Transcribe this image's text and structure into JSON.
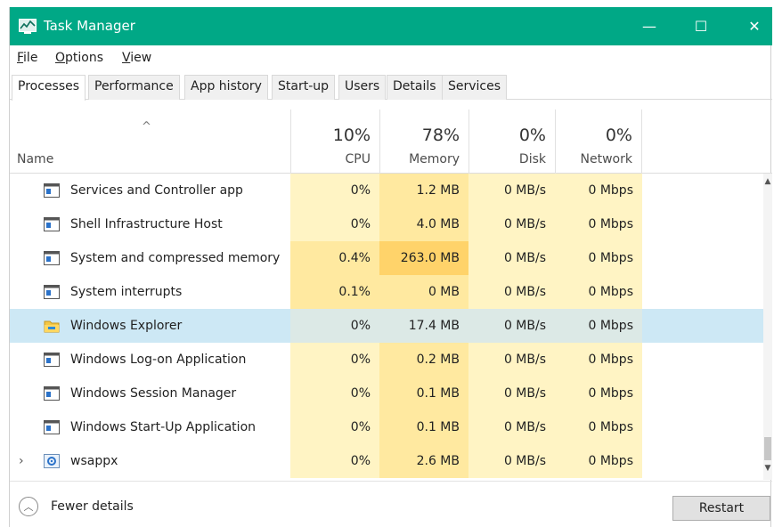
{
  "window": {
    "title": "Task Manager",
    "minimize": "—",
    "maximize": "☐",
    "close": "✕"
  },
  "menu": {
    "file": "File",
    "options": "Options",
    "view": "View"
  },
  "tabs": [
    "Processes",
    "Performance",
    "App history",
    "Start-up",
    "Users",
    "Details",
    "Services"
  ],
  "header": {
    "name_label": "Name",
    "sort_indicator": "^",
    "cpu": {
      "pct": "10%",
      "label": "CPU"
    },
    "memory": {
      "pct": "78%",
      "label": "Memory"
    },
    "disk": {
      "pct": "0%",
      "label": "Disk"
    },
    "network": {
      "pct": "0%",
      "label": "Network"
    }
  },
  "processes": [
    {
      "name": "Services and Controller app",
      "cpu": "0%",
      "memory": "1.2 MB",
      "disk": "0 MB/s",
      "network": "0 Mbps",
      "icon": "window-icon",
      "expandable": false,
      "selected": false
    },
    {
      "name": "Shell Infrastructure Host",
      "cpu": "0%",
      "memory": "4.0 MB",
      "disk": "0 MB/s",
      "network": "0 Mbps",
      "icon": "window-icon",
      "expandable": false,
      "selected": false
    },
    {
      "name": "System and compressed memory",
      "cpu": "0.4%",
      "memory": "263.0 MB",
      "disk": "0 MB/s",
      "network": "0 Mbps",
      "icon": "window-icon",
      "expandable": false,
      "selected": false
    },
    {
      "name": "System interrupts",
      "cpu": "0.1%",
      "memory": "0 MB",
      "disk": "0 MB/s",
      "network": "0 Mbps",
      "icon": "window-icon",
      "expandable": false,
      "selected": false
    },
    {
      "name": "Windows Explorer",
      "cpu": "0%",
      "memory": "17.4 MB",
      "disk": "0 MB/s",
      "network": "0 Mbps",
      "icon": "folder-icon",
      "expandable": false,
      "selected": true
    },
    {
      "name": "Windows Log-on Application",
      "cpu": "0%",
      "memory": "0.2 MB",
      "disk": "0 MB/s",
      "network": "0 Mbps",
      "icon": "window-icon",
      "expandable": false,
      "selected": false
    },
    {
      "name": "Windows Session Manager",
      "cpu": "0%",
      "memory": "0.1 MB",
      "disk": "0 MB/s",
      "network": "0 Mbps",
      "icon": "window-icon",
      "expandable": false,
      "selected": false
    },
    {
      "name": "Windows Start-Up Application",
      "cpu": "0%",
      "memory": "0.1 MB",
      "disk": "0 MB/s",
      "network": "0 Mbps",
      "icon": "window-icon",
      "expandable": false,
      "selected": false
    },
    {
      "name": "wsappx",
      "cpu": "0%",
      "memory": "2.6 MB",
      "disk": "0 MB/s",
      "network": "0 Mbps",
      "icon": "gear-icon",
      "expandable": true,
      "selected": false
    }
  ],
  "footer": {
    "fewer_details": "Fewer details",
    "restart": "Restart"
  },
  "colors": {
    "titlebar": "#00a886",
    "heat_light": "#fff4c4",
    "heat_medium": "#ffe9a0",
    "heat_high": "#ffd36a",
    "selected_row": "#cde8f5",
    "selected_heat": "#dce9e6"
  }
}
